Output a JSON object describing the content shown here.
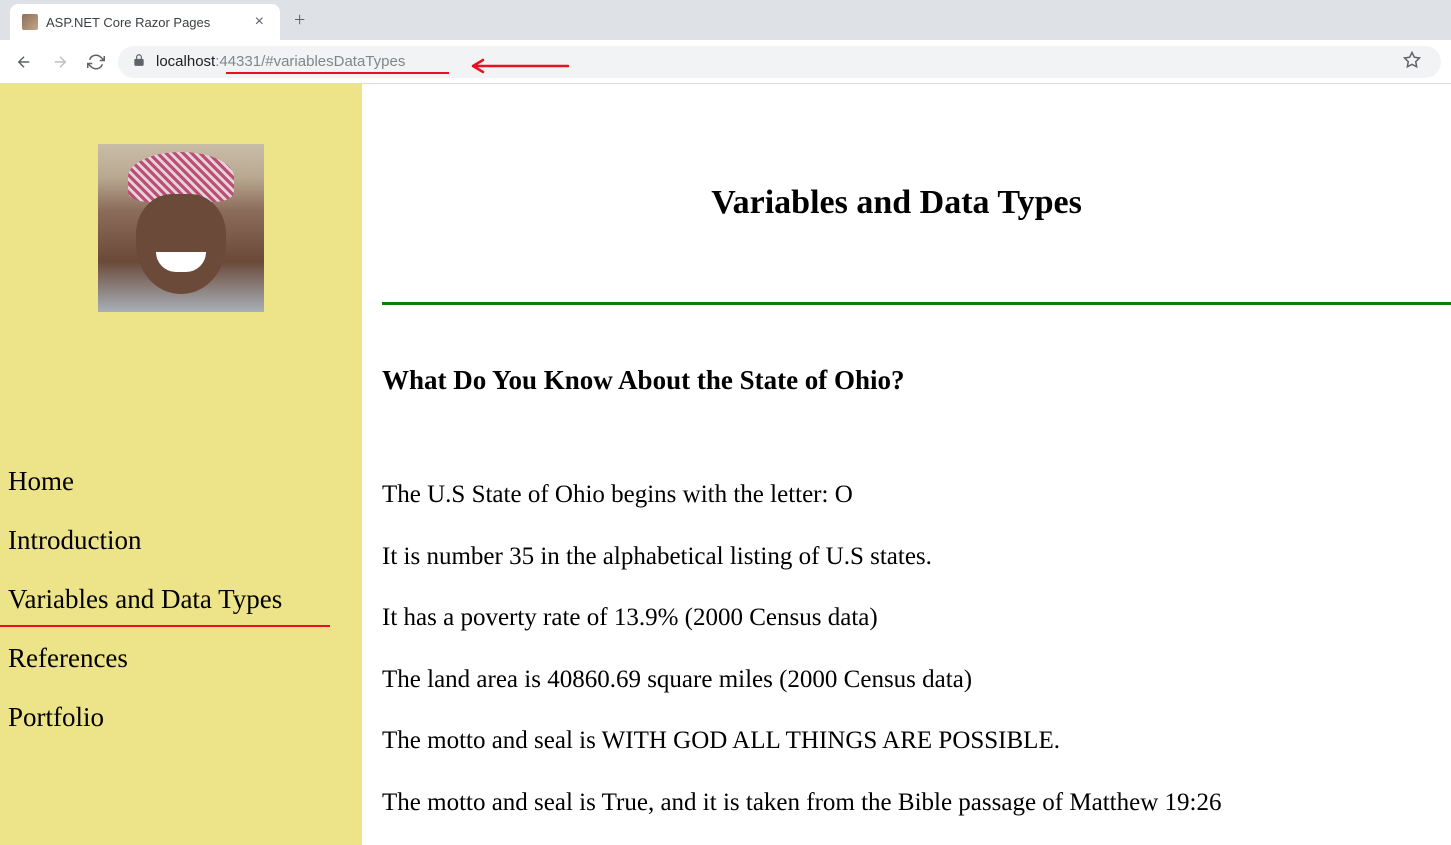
{
  "browser": {
    "tab_title": "ASP.NET Core Razor Pages",
    "url_host": "localhost",
    "url_port": ":44331/",
    "url_frag": "#variablesDataTypes"
  },
  "sidebar": {
    "nav": [
      {
        "label": "Home"
      },
      {
        "label": "Introduction"
      },
      {
        "label": "Variables and Data Types"
      },
      {
        "label": "References"
      },
      {
        "label": "Portfolio"
      }
    ]
  },
  "main": {
    "title": "Variables and Data Types",
    "section_heading": "What Do You Know About the State of Ohio?",
    "lines": [
      "The U.S State of Ohio begins with the letter: O",
      "It is number 35 in the alphabetical listing of U.S states.",
      "It has a poverty rate of 13.9% (2000 Census data)",
      "The land area is 40860.69 square miles (2000 Census data)",
      "The motto and seal is WITH GOD ALL THINGS ARE POSSIBLE.",
      "The motto and seal is True, and it is taken from the Bible passage of Matthew 19:26"
    ]
  }
}
